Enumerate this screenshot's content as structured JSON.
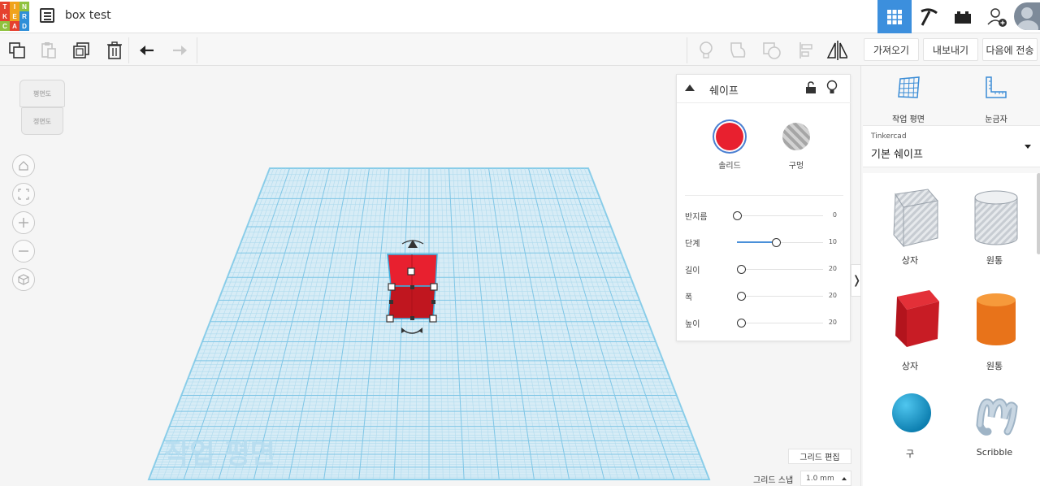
{
  "app": {
    "logo_letters": [
      "T",
      "I",
      "N",
      "K",
      "E",
      "R",
      "C",
      "A",
      "D"
    ],
    "logo_colors": [
      "#e5412f",
      "#f0a31b",
      "#8fc23f",
      "#e5412f",
      "#f0a31b",
      "#2f8fd8",
      "#8fc23f",
      "#e5412f",
      "#2f8fd8"
    ],
    "project_title": "box test"
  },
  "top_icons": {
    "list": "list-icon",
    "view_3d": "grid-3d-icon",
    "pickaxe": "pickaxe-icon",
    "bricks": "brick-icon",
    "add_user": "add-user-icon"
  },
  "toolbar": {
    "import_label": "가져오기",
    "export_label": "내보내기",
    "send_to_label": "다음에 전송"
  },
  "viewcube": {
    "top_label": "평면도",
    "front_label": "정면도"
  },
  "workplane": {
    "watermark": "작업 평면",
    "accent": "#3ab0e0"
  },
  "inspector": {
    "title": "쉐이프",
    "solid_label": "솔리드",
    "hole_label": "구멍",
    "solid_color": "#e8202f",
    "params": [
      {
        "label": "반지름",
        "value": "0",
        "fraction": 0.0
      },
      {
        "label": "단계",
        "value": "10",
        "fraction": 0.45
      },
      {
        "label": "길이",
        "value": "20",
        "fraction": 0.05
      },
      {
        "label": "폭",
        "value": "20",
        "fraction": 0.05
      },
      {
        "label": "높이",
        "value": "20",
        "fraction": 0.05
      }
    ]
  },
  "right_panel": {
    "workplane_label": "작업 평면",
    "ruler_label": "눈금자",
    "library_source": "Tinkercad",
    "library_name": "기본 쉐이프",
    "shapes": [
      {
        "label": "상자",
        "icon": "box-hole-icon"
      },
      {
        "label": "원통",
        "icon": "cylinder-hole-icon"
      },
      {
        "label": "상자",
        "icon": "box-icon"
      },
      {
        "label": "원통",
        "icon": "cylinder-icon"
      },
      {
        "label": "구",
        "icon": "sphere-icon"
      },
      {
        "label": "Scribble",
        "icon": "scribble-icon"
      }
    ]
  },
  "bottom": {
    "grid_edit_label": "그리드 편집",
    "snap_label": "그리드 스냅",
    "snap_value": "1.0 mm"
  }
}
